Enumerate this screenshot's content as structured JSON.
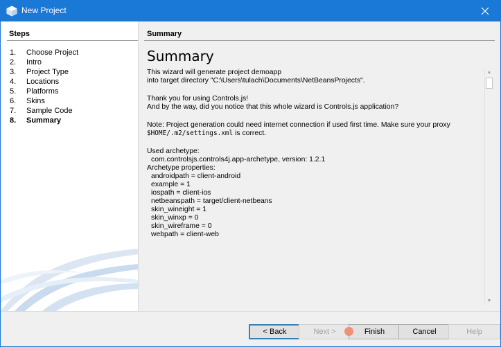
{
  "window": {
    "title": "New Project",
    "close_symbol": "✕"
  },
  "steps": {
    "header": "Steps",
    "items": [
      {
        "num": "1.",
        "label": "Choose Project"
      },
      {
        "num": "2.",
        "label": "Intro"
      },
      {
        "num": "3.",
        "label": "Project Type"
      },
      {
        "num": "4.",
        "label": "Locations"
      },
      {
        "num": "5.",
        "label": "Platforms"
      },
      {
        "num": "6.",
        "label": "Skins"
      },
      {
        "num": "7.",
        "label": "Sample Code"
      },
      {
        "num": "8.",
        "label": "Summary",
        "active": true
      }
    ]
  },
  "summary": {
    "header": "Summary",
    "title": "Summary",
    "lines": {
      "l1": "This wizard will generate project demoapp",
      "l2": "into target directory \"C:\\Users\\tulach\\Documents\\NetBeansProjects\".",
      "l3": "Thank you for using Controls.js!",
      "l4": "And by the way, did you notice that this whole wizard is Controls.js application?",
      "l5": "Note: Project generation could need internet connection if used first time. Make sure your proxy",
      "l6_code": "$HOME/.m2/settings.xml",
      "l6_rest": " is correct.",
      "l7": "Used archetype:",
      "l8": "com.controlsjs.controls4j.app-archetype, version: 1.2.1",
      "l9": "Archetype properties:",
      "p1": "androidpath = client-android",
      "p2": "example = 1",
      "p3": "iospath = client-ios",
      "p4": "netbeanspath = target/client-netbeans",
      "p5": "skin_wineight = 1",
      "p6": "skin_winxp = 0",
      "p7": "skin_wireframe = 0",
      "p8": "webpath = client-web"
    }
  },
  "buttons": {
    "back": "< Back",
    "next": "Next >",
    "finish": "Finish",
    "cancel": "Cancel",
    "help": "Help"
  },
  "colors": {
    "titlebar": "#1a78d6",
    "accent": "#3c7fb1"
  }
}
